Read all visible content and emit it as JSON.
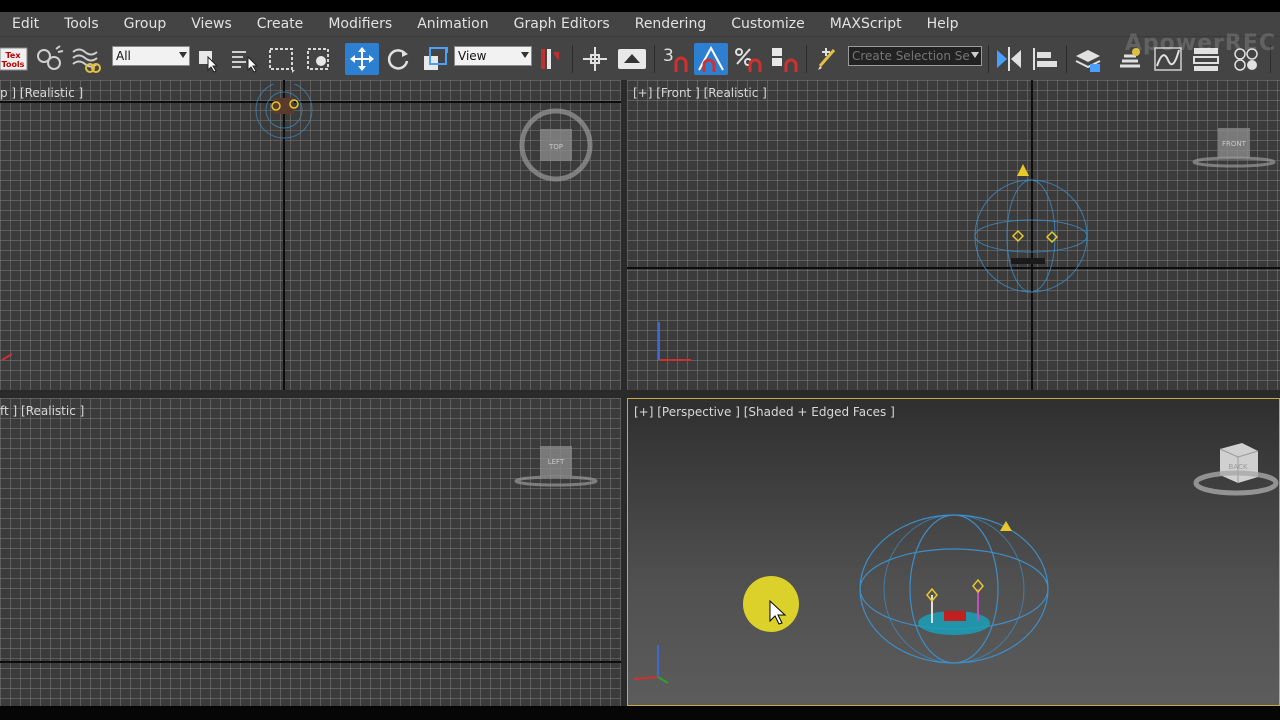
{
  "menu": {
    "items": [
      "Edit",
      "Tools",
      "Group",
      "Views",
      "Create",
      "Modifiers",
      "Animation",
      "Graph Editors",
      "Rendering",
      "Customize",
      "MAXScript",
      "Help"
    ]
  },
  "toolbar": {
    "tex_tools_label_1": "Tex",
    "tex_tools_label_2": "Tools",
    "selection_filter": "All",
    "reference_coord": "View",
    "snap_label": "3",
    "named_selection_placeholder": "Create Selection Se",
    "watermark": "ApowerREC"
  },
  "viewports": {
    "top": {
      "label": "p ] [Realistic ]",
      "cube_label": "TOP"
    },
    "front": {
      "label": "[+] [Front ] [Realistic ]",
      "cube_label": "FRONT"
    },
    "left": {
      "label": "ft ] [Realistic ]",
      "cube_label": "LEFT"
    },
    "perspective": {
      "label": "[+] [Perspective ] [Shaded + Edged Faces ]",
      "cube_label": "BACK"
    }
  },
  "colors": {
    "menu_bg": "#444444",
    "viewport_bg": "#3b3b3b",
    "active_tool": "#2d7fd2",
    "active_viewport_border": "#c9a84a",
    "cursor_halo": "#e8dc28",
    "light_gizmo": "#e8c82a",
    "helper_wire": "#3d8fc9"
  },
  "icons": [
    "tex-tools-icon",
    "link-icon",
    "unlink-icon",
    "bind-space-warp-icon",
    "select-object-icon",
    "select-by-name-icon",
    "rectangle-selection-icon",
    "window-crossing-icon",
    "select-move-icon",
    "select-rotate-icon",
    "select-scale-icon",
    "select-place-icon",
    "use-pivot-icon",
    "keyboard-shortcut-override-icon",
    "snap-toggle-icon",
    "angle-snap-icon",
    "percent-snap-icon",
    "spinner-snap-icon",
    "edit-named-selections-icon",
    "mirror-icon",
    "align-icon",
    "toggle-scene-explorer-icon",
    "toggle-layer-explorer-icon",
    "curve-editor-icon",
    "schematic-view-icon",
    "material-editor-icon"
  ]
}
